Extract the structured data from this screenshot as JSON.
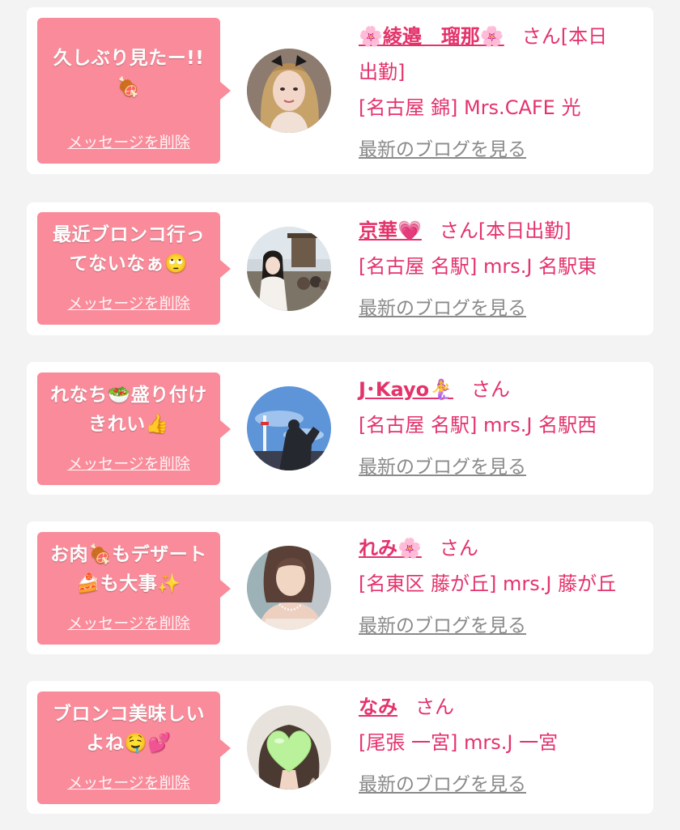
{
  "messages": [
    {
      "bubble_text": "久しぶり見たー!!🍖",
      "delete_label": "メッセージを削除",
      "name": "🌸綾邉　瑠那🌸",
      "suffix": "さん[本日出勤]",
      "shop": "[名古屋 錦] Mrs.CAFE 光",
      "blog_label": "最新のブログを見る",
      "avatar_desc": "woman with dark hair bow"
    },
    {
      "bubble_text": "最近ブロンコ行ってないなぁ🙄",
      "delete_label": "メッセージを削除",
      "name": "京華💗",
      "suffix": "さん[本日出勤]",
      "shop": "[名古屋 名駅] mrs.J 名駅東",
      "blog_label": "最新のブログを見る",
      "avatar_desc": "woman at shrine street"
    },
    {
      "bubble_text": "れなち🥗盛り付けきれい👍",
      "delete_label": "メッセージを削除",
      "name": "J･Kayo🧜‍♀️",
      "suffix": "さん",
      "shop": "[名古屋 名駅] mrs.J 名駅西",
      "blog_label": "最新のブログを見る",
      "avatar_desc": "silhouette with tower and blue sky"
    },
    {
      "bubble_text": "お肉🍖もデザート🍰も大事✨",
      "delete_label": "メッセージを削除",
      "name": "れみ🌸",
      "suffix": "さん",
      "shop": "[名東区 藤が丘] mrs.J 藤が丘",
      "blog_label": "最新のブログを見る",
      "avatar_desc": "woman with necklace"
    },
    {
      "bubble_text": "ブロンコ美味しいよね🤤💕",
      "delete_label": "メッセージを削除",
      "name": "なみ",
      "suffix": "さん",
      "shop": "[尾張 一宮] mrs.J 一宮",
      "blog_label": "最新のブログを見る",
      "avatar_desc": "face hidden by green heart"
    }
  ],
  "colors": {
    "bubble": "#f98b9a",
    "accent": "#e4336b",
    "link_gray": "#8a8a8a",
    "card": "#ffffff",
    "background": "#f3f3f3"
  }
}
